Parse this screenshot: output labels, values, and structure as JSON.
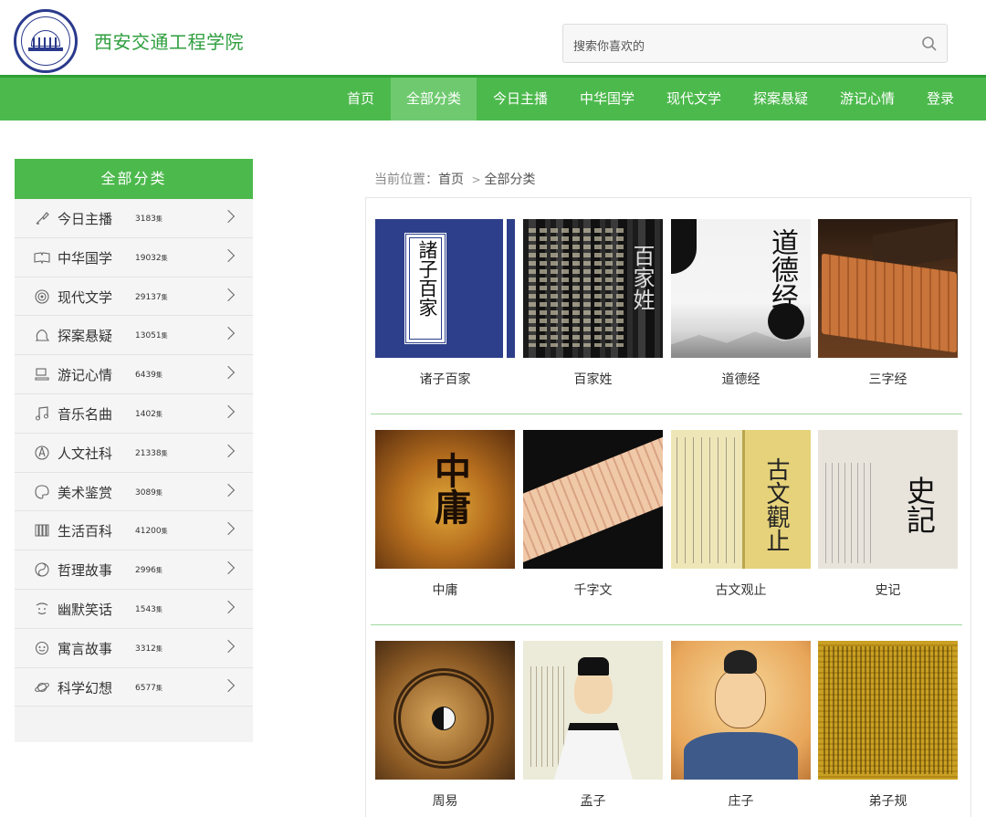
{
  "header": {
    "site_title": "西安交通工程学院",
    "search_placeholder": "搜索你喜欢的"
  },
  "nav": {
    "items": [
      "首页",
      "全部分类",
      "今日主播",
      "中华国学",
      "现代文学",
      "探案悬疑",
      "游记心情",
      "登录"
    ],
    "active": "全部分类"
  },
  "sidebar": {
    "title": "全部分类",
    "count_unit": "集",
    "items": [
      {
        "label": "今日主播",
        "count": "3183",
        "icon": "brush-icon"
      },
      {
        "label": "中华国学",
        "count": "19032",
        "icon": "open-book-icon"
      },
      {
        "label": "现代文学",
        "count": "29137",
        "icon": "fingerprint-icon"
      },
      {
        "label": "探案悬疑",
        "count": "13051",
        "icon": "detective-icon"
      },
      {
        "label": "游记心情",
        "count": "6439",
        "icon": "travel-icon"
      },
      {
        "label": "音乐名曲",
        "count": "1402",
        "icon": "music-note-icon"
      },
      {
        "label": "人文社科",
        "count": "21338",
        "icon": "compass-icon"
      },
      {
        "label": "美术鉴赏",
        "count": "3089",
        "icon": "palette-icon"
      },
      {
        "label": "生活百科",
        "count": "41200",
        "icon": "books-icon"
      },
      {
        "label": "哲理故事",
        "count": "2996",
        "icon": "yin-yang-icon"
      },
      {
        "label": "幽默笑话",
        "count": "1543",
        "icon": "smile-icon"
      },
      {
        "label": "寓言故事",
        "count": "3312",
        "icon": "face-icon"
      },
      {
        "label": "科学幻想",
        "count": "6577",
        "icon": "planet-icon"
      }
    ]
  },
  "breadcrumb": {
    "prefix": "当前位置：",
    "home": "首页",
    "separator": ">",
    "current": "全部分类"
  },
  "grid": {
    "items": [
      {
        "title": "诸子百家",
        "thumb_text": "諸子百家"
      },
      {
        "title": "百家姓",
        "thumb_text": "百家姓"
      },
      {
        "title": "道德经",
        "thumb_text": "道德经"
      },
      {
        "title": "三字经",
        "thumb_text": ""
      },
      {
        "title": "中庸",
        "thumb_text": "中庸"
      },
      {
        "title": "千字文",
        "thumb_text": ""
      },
      {
        "title": "古文观止",
        "thumb_text": "古文觀止"
      },
      {
        "title": "史记",
        "thumb_text": "史記"
      },
      {
        "title": "周易",
        "thumb_text": ""
      },
      {
        "title": "孟子",
        "thumb_text": ""
      },
      {
        "title": "庄子",
        "thumb_text": ""
      },
      {
        "title": "弟子规",
        "thumb_text": ""
      }
    ]
  },
  "colors": {
    "brand_green": "#4cb94c",
    "nav_active": "#6fca6f",
    "title_green": "#2e9e3e",
    "logo_blue": "#2a3a8c"
  }
}
